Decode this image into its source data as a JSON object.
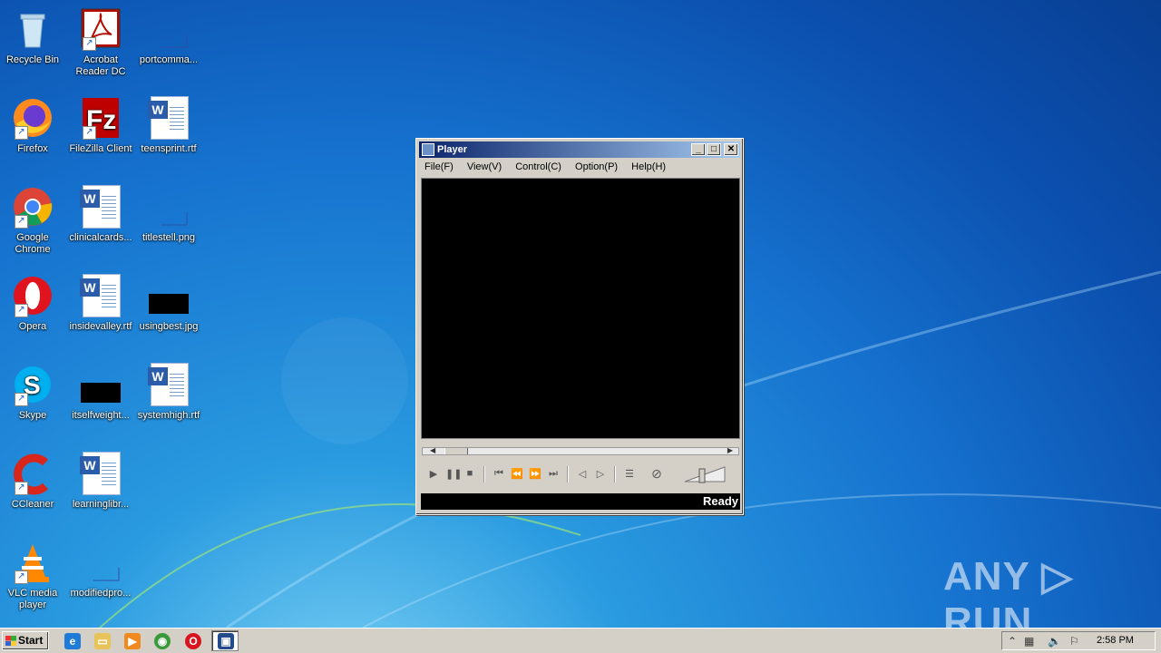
{
  "desktop": {
    "icons": [
      {
        "label": "Recycle Bin",
        "icon": "recycle-bin-icon"
      },
      {
        "label": "Acrobat Reader DC",
        "icon": "acrobat-icon"
      },
      {
        "label": "portcomma...",
        "icon": "blank-file-icon"
      },
      {
        "label": "Firefox",
        "icon": "firefox-icon"
      },
      {
        "label": "FileZilla Client",
        "icon": "filezilla-icon"
      },
      {
        "label": "teensprint.rtf",
        "icon": "word-document-icon"
      },
      {
        "label": "Google Chrome",
        "icon": "chrome-icon"
      },
      {
        "label": "clinicalcards...",
        "icon": "word-document-icon"
      },
      {
        "label": "titlestell.png",
        "icon": "blank-file-icon"
      },
      {
        "label": "Opera",
        "icon": "opera-icon"
      },
      {
        "label": "insidevalley.rtf",
        "icon": "word-document-icon"
      },
      {
        "label": "usingbest.jpg",
        "icon": "image-file-icon"
      },
      {
        "label": "Skype",
        "icon": "skype-icon"
      },
      {
        "label": "itselfweight...",
        "icon": "image-file-icon"
      },
      {
        "label": "systemhigh.rtf",
        "icon": "word-document-icon"
      },
      {
        "label": "CCleaner",
        "icon": "ccleaner-icon"
      },
      {
        "label": "learninglibr...",
        "icon": "word-document-icon"
      },
      {
        "label": "VLC media player",
        "icon": "vlc-icon"
      },
      {
        "label": "modifiedpro...",
        "icon": "blank-file-icon"
      }
    ]
  },
  "player": {
    "title": "Player",
    "menu": [
      "File(F)",
      "View(V)",
      "Control(C)",
      "Option(P)",
      "Help(H)"
    ],
    "status": "Ready",
    "minimize": "_",
    "maximize": "□",
    "close": "✕"
  },
  "taskbar": {
    "start_label": "Start",
    "clock": "2:58 PM"
  },
  "watermark": "ANY ▷ RUN",
  "colors": {
    "accent": "#0a246a",
    "desktop": "#1673cf"
  }
}
